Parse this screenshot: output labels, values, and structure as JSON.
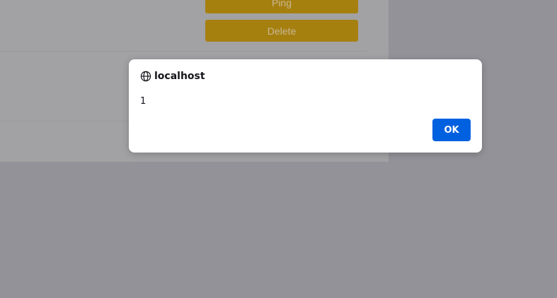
{
  "page": {
    "ping_label": "Ping",
    "delete_label": "Delete",
    "button_color": "#a6800f",
    "overlay_color": "#939298"
  },
  "alert": {
    "origin": "localhost",
    "message": "1",
    "ok_label": "OK",
    "icon": "globe-icon",
    "ok_color": "#0061e0"
  }
}
